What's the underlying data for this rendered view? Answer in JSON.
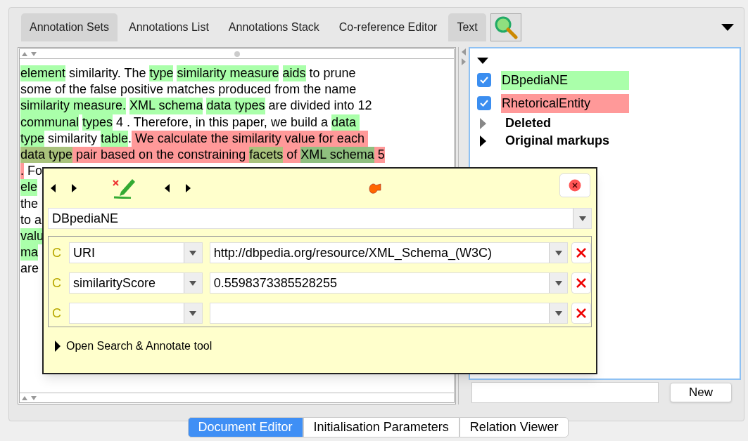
{
  "top_tabs": [
    {
      "label": "Annotation Sets",
      "selected": true
    },
    {
      "label": "Annotations List",
      "selected": false
    },
    {
      "label": "Annotations Stack",
      "selected": false
    },
    {
      "label": "Co-reference Editor",
      "selected": false
    },
    {
      "label": "Text",
      "selected": true
    }
  ],
  "document_text": {
    "lines": [
      [
        {
          "text": "element",
          "color": "#aaffaa"
        },
        {
          "text": " similarity. The "
        },
        {
          "text": "type",
          "color": "#aaffaa"
        },
        {
          "text": "similarity measure",
          "color": "#aaffaa"
        },
        {
          "text": "aids",
          "color": "#aaffaa"
        },
        {
          "text": " to prune"
        }
      ],
      [
        {
          "text": "some of the false positive matches produced from the name"
        }
      ],
      [
        {
          "text": "similarity measure.",
          "color": "#aaffaa"
        },
        {
          "text": "XML schema",
          "color": "#aaffaa"
        },
        {
          "text": "data types",
          "color": "#aaffaa"
        },
        {
          "text": " are divided into 12"
        }
      ],
      [
        {
          "text": "communal",
          "color": "#aaffaa"
        },
        {
          "text": "types",
          "color": "#aaffaa"
        },
        {
          "text": " 4 . Therefore, in this paper, we build a "
        },
        {
          "text": "data ",
          "color": "#aaffaa"
        }
      ],
      [
        {
          "text": "type",
          "color": "#aaffaa"
        },
        {
          "text": " similarity "
        },
        {
          "text": "table",
          "color": "#aaffaa"
        },
        {
          "text": "."
        },
        {
          "text": " We calculate the similarity value for each ",
          "color": "#ff9999"
        }
      ],
      [
        {
          "text": "data type",
          "color": "#a9c27c"
        },
        {
          "text": " pair based on the constraining ",
          "color": "#ff9999"
        },
        {
          "text": "facets",
          "color": "#a9c27c"
        },
        {
          "text": " of ",
          "color": "#ff9999"
        },
        {
          "text": "XML schema",
          "color": "#8fbf7f"
        },
        {
          "text": " 5",
          "color": "#ff9999"
        }
      ],
      [
        {
          "text": ".",
          "color": "#ff9999"
        },
        {
          "text": " Fo"
        }
      ],
      [
        {
          "text": "ele",
          "color": "#aaffaa"
        }
      ],
      [
        {
          "text": "the"
        }
      ],
      [
        {
          "text": "to a"
        }
      ],
      [
        {
          "text": "valu",
          "color": "#aaffaa"
        }
      ],
      [
        {
          "text": "ma",
          "color": "#aaffaa"
        }
      ],
      [
        {
          "text": "are"
        }
      ]
    ]
  },
  "annotation_sets": {
    "expanded": true,
    "children": [
      {
        "kind": "type",
        "label": "DBpediaNE",
        "checked": true,
        "color": "#aaffaa"
      },
      {
        "kind": "type",
        "label": "RhetoricalEntity",
        "checked": true,
        "color": "#ff9999"
      },
      {
        "kind": "set",
        "label": "Deleted",
        "expanded": false,
        "empty": true
      },
      {
        "kind": "set",
        "label": "Original markups",
        "expanded": false,
        "empty": false
      }
    ]
  },
  "new_set": {
    "button": "New"
  },
  "annotation_editor": {
    "type": "DBpediaNE",
    "features": [
      {
        "marker": "C",
        "name": "URI",
        "value": "http://dbpedia.org/resource/XML_Schema_(W3C)"
      },
      {
        "marker": "C",
        "name": "similarityScore",
        "value": "0.5598373385528255"
      },
      {
        "marker": "C"
      }
    ],
    "search_tool": {
      "label": "Open Search & Annotate tool",
      "expanded": false
    }
  },
  "bottom_tabs": [
    {
      "label": "Document Editor",
      "selected": true
    },
    {
      "label": "Initialisation Parameters",
      "selected": false
    },
    {
      "label": "Relation Viewer",
      "selected": false
    }
  ]
}
